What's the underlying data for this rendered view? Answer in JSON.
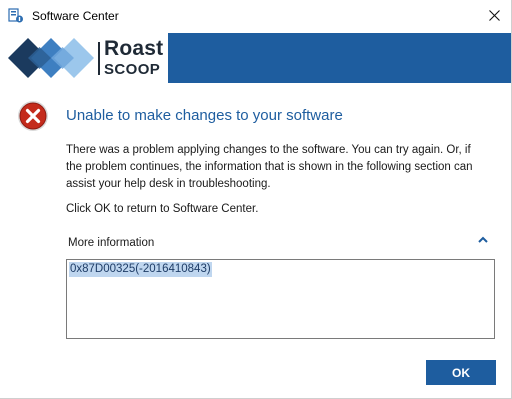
{
  "window": {
    "title": "Software Center",
    "icon": "software-center-icon",
    "close_icon": "close-icon"
  },
  "banner": {
    "color": "#1e5d9f",
    "logo_line1": "Roast",
    "logo_line2": "SCOOP"
  },
  "dialog": {
    "icon": "error-icon",
    "heading": "Unable to make changes to your software",
    "message": "There was a problem applying changes to the software.  You can try again. Or, if the problem continues, the information that is shown in the following section can assist your help desk in troubleshooting.",
    "instruction": "Click OK to return to Software Center.",
    "more_info_label": "More information",
    "collapse_icon": "chevron-up-icon",
    "error_code": "0x87D00325(-2016410843)",
    "ok_label": "OK"
  },
  "colors": {
    "accent": "#1e5d9f",
    "error_red": "#c42b1c"
  }
}
